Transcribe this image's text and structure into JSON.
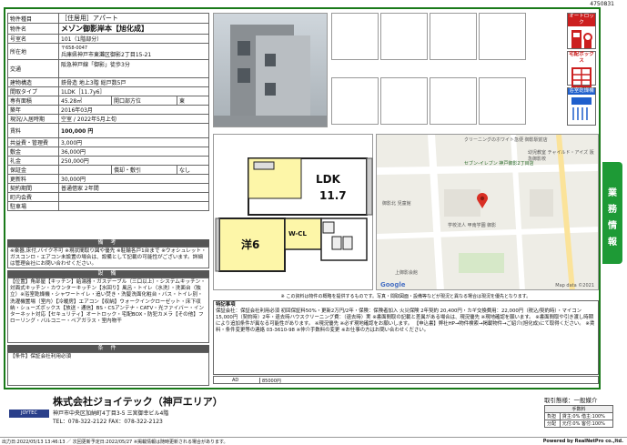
{
  "ref_no": "4750831",
  "spec": {
    "type_label": "物件種目",
    "type_value": "［住居用］アパート",
    "name_label": "物件名",
    "name_value": "メゾン御影岸本【旭化成】",
    "room_label": "号室名",
    "room_value": "101（1階部分）",
    "addr_label": "所在地",
    "addr_zip": "〒658-0047",
    "addr_value": "兵庫県神戸市東灘区御影2丁目15-21",
    "traffic_label": "交通",
    "traffic_value": "阪急神戸線「御影」徒歩3分",
    "struct_label": "建物構造",
    "struct_value": "鉄骨造 地上3階 総戸数5戸",
    "layout_label": "間取タイプ",
    "layout_value": "1LDK［11.7y6］",
    "area_label": "専有面積",
    "area_value": "45.28㎡",
    "dir_label": "開口部方位",
    "dir_value": "東",
    "built_label": "築年",
    "built_value": "2016年03月",
    "status_label": "現況/入居時期",
    "status_value": "空室 / 2022年5月上旬",
    "rent_label": "賃料",
    "rent_value": "100,000 円",
    "mgmt_label": "共益費・管理費",
    "mgmt_value": "3,000円",
    "deposit_label": "敷金",
    "deposit_value": "36,000円",
    "key_label": "礼金",
    "key_value": "250,000円",
    "guar_label": "保証金",
    "guar_value": "",
    "amort_label": "償却・敷引",
    "amort_value": "なし",
    "renew_label": "更新料",
    "renew_value": "30,000円",
    "contract_label": "契約期間",
    "contract_value": "普通借家 2年間",
    "assoc_label": "町内会費",
    "assoc_value": "",
    "parking_label": "駐車場",
    "parking_value": ""
  },
  "remarks_head": "備 考",
  "remarks_text": "※楽器,床付,バイク不可 ※現状間取り図や優先 ※駐輪各戸1台まで ※ウォシュレット・ガスコンロ・エアコン未設置の場合は、設備として記載の可能性がございます。詳細は管理会社にお問い合わせください。",
  "equip_head": "設 備",
  "equip_text": "【位置】角部屋【キッチン】給湯器・ガスデーブル（三口以上）・システムキッチン・対面式キッチン・カウンターキッチン【水回り】風呂・トイレ（水洗）・洗面台（独立）※浴室乾燥機・シャワートイレ・追い焚き・洗髪洗面化粧台・バス・トイレ別・洗濯機置場（室内）【冷暖房】エアコン【収納】ウォークインクローゼット・床下収納・シューズボックス【放送・通信】BS・CSアンテナ・CATV・光ファイバー・インターネット対応【セキュリティ】オートロック・宅配BOX・防犯カメラ【その他】フローリング・バルコニー・ペアガラス・室内物干",
  "cond_head": "条 件",
  "cond_text": "【条件】保証会社利用必須",
  "icons": [
    {
      "name": "オートロック",
      "color": "#cc1f1f"
    },
    {
      "name": "宅配ボックス",
      "color": "#cc1f1f"
    },
    {
      "name": "浴室乾燥機",
      "color": "#1f5fcc"
    }
  ],
  "plan": {
    "ldk": "LDK",
    "ldk_size": "11.7",
    "yo": "洋6",
    "wcl": "W-CL"
  },
  "map": {
    "label1": "クリーニングのホワイト急便 御影駅前店",
    "label2": "セブン-イレブン 神戸御影2丁目店",
    "label3": "幼児教室 チャイルド・アイズ 阪急御影校",
    "label4": "御影北 児童館",
    "label5": "学校法人 甲南学園 御影",
    "label6": "上御影会館",
    "google": "Google",
    "mapdata": "Map data ©2021"
  },
  "note": "※ この資料は物件の概略を提供するものです。写真・間取図面・設備等などが現況と異なる場合は現況を優先となります。",
  "remark_title": "特記事項",
  "remark_text": "保証会社：保証会社利用必須 初回保証料50%・更新2万円/2年・保険：保険者加入 火災保険 2年契約 20,400円・カギ交換費用：22,000円（税込/契約時）・マイコン 15,000円（契約時）2年・退去時ハウスクリーニング費：（退去時）実 ※書面間取の記載と差異がある場合は、現況優先 ※現地確認を願います。 ※書面間取や引き渡し時期により追加条件が異なる可能性があります。 ※現況優先 ※必ず現地確認をお願いします。 【申込書】弊社HP→物件検索→掲載物件→ご紹介(旭化成)にて取得ください。 ※賃料・条件変更等の連絡 03-3610-98 ※仲介手数料の変更 ※お仕事の方はお問い合わせください。",
  "ad_label": "AD",
  "ad_value": "85000円",
  "company": "株式会社ジョイテック（神戸エリア）",
  "company_addr": "神戸市中央区加納町4丁目3-5 三宮御幸ビル4階",
  "company_tel": "TEL：078-322-2122  FAX：078-322-2123",
  "company_logo": "JOYTEC",
  "fee_title": "取引態様：一般媒介",
  "fee_sub": "手数料",
  "fee_rows": [
    [
      "負担",
      "貸主:0% 借主:100%"
    ],
    [
      "分配",
      "元付:0% 客付:100%"
    ]
  ],
  "side_tab": [
    "業",
    "務",
    "情",
    "報"
  ],
  "print_date": "出力日:2022/05/13 13:46:13 ／ 次回更新予定日:2022/05/27 ※掲載情報は随時更新される場合があります。",
  "powered": "Powered by RealNetPro co.,ltd."
}
